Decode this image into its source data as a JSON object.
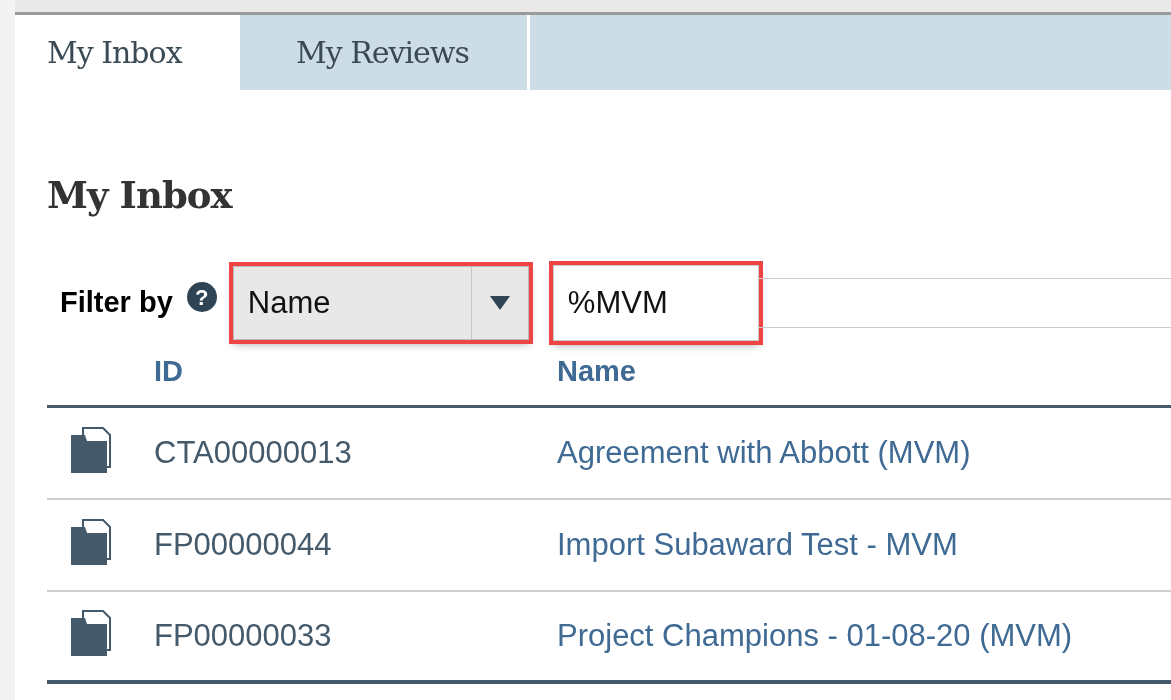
{
  "tabs": [
    {
      "label": "My Inbox",
      "selected": true
    },
    {
      "label": "My Reviews",
      "selected": false
    }
  ],
  "heading": "My Inbox",
  "filter": {
    "label": "Filter by",
    "help_icon": "?",
    "select": {
      "value": "Name",
      "highlighted": true
    },
    "input": {
      "value": "%MVM",
      "highlighted": true
    }
  },
  "table": {
    "columns": [
      "ID",
      "Name"
    ],
    "rows": [
      {
        "id": "CTA00000013",
        "name": "Agreement with Abbott (MVM)"
      },
      {
        "id": "FP00000044",
        "name": "Import Subaward Test - MVM"
      },
      {
        "id": "FP00000033",
        "name": "Project Champions - 01-08-20 (MVM)"
      }
    ]
  }
}
